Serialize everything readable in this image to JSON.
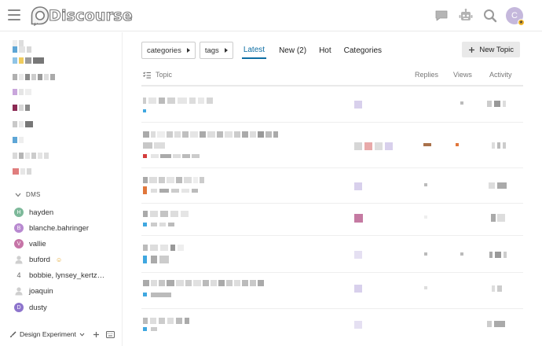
{
  "header": {
    "logo_text": "Discourse",
    "icons": [
      "hamburger-icon",
      "chat-icon",
      "assistant-bot-icon",
      "search-icon",
      "user-avatar"
    ],
    "avatar_letter": "C"
  },
  "sidebar": {
    "dms_label": "DMS",
    "dms": [
      {
        "name": "hayden",
        "avatar": "H",
        "color": "#7db99a"
      },
      {
        "name": "blanche.bahringer",
        "avatar": "B",
        "color": "#b889d0"
      },
      {
        "name": "vallie",
        "avatar": "V",
        "color": "#c674a7"
      },
      {
        "name": "buford",
        "avatar": "",
        "color": "#cfcfcf"
      },
      {
        "name": "bobbie, lynsey_kertz…",
        "avatar": "4",
        "color": ""
      },
      {
        "name": "joaquin",
        "avatar": "",
        "color": "#cfcfcf"
      },
      {
        "name": "dusty",
        "avatar": "D",
        "color": "#8d74cc"
      }
    ],
    "footer_label": "Design Experiment"
  },
  "navigation": {
    "categories_label": "categories",
    "tags_label": "tags",
    "tabs": [
      "Latest",
      "New (2)",
      "Hot",
      "Categories"
    ],
    "active_tab": "Latest",
    "new_topic_label": "New Topic"
  },
  "topic_list": {
    "columns": {
      "topic": "Topic",
      "replies": "Replies",
      "views": "Views",
      "activity": "Activity"
    }
  },
  "colors": {
    "accent": "#0d6ea3",
    "category_blue": "#3fa7e0",
    "category_red": "#d43c3c",
    "category_orange": "#e0763b"
  }
}
